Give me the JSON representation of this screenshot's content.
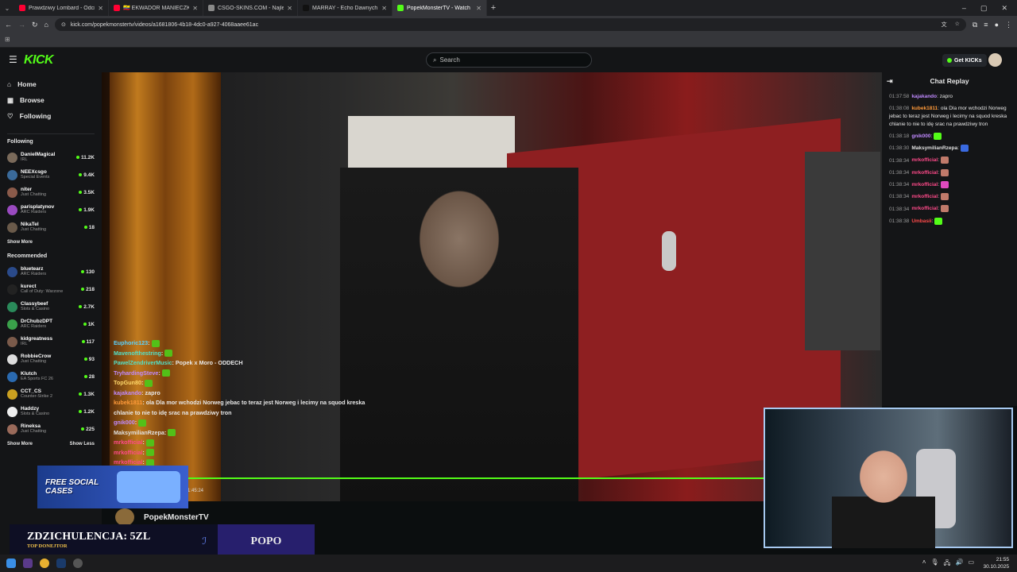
{
  "browser": {
    "tabs": [
      {
        "title": "Prawdziwy Lombard - Odcinek",
        "color": "#ff0033"
      },
      {
        "title": "🇪🇨 EKWADOR MANIECZKI",
        "color": "#ff0033"
      },
      {
        "title": "CSGO-SKINS.COM - Najlepsze",
        "color": "#8a8a8a"
      },
      {
        "title": "MARRAY - Echo Dawnych Lat |",
        "color": "#111111"
      },
      {
        "title": "PopekMonsterTV - Watch",
        "color": "#53fc18"
      }
    ],
    "url": "kick.com/popekmonstertv/videos/a1681806-4b18-4dc0-a927-4068aaee61ac"
  },
  "header": {
    "logo": "KICK",
    "search_placeholder": "Search",
    "get_kicks": "Get KICKs"
  },
  "sidebar": {
    "nav": [
      {
        "label": "Home",
        "icon": "home-icon"
      },
      {
        "label": "Browse",
        "icon": "browse-icon"
      },
      {
        "label": "Following",
        "icon": "heart-icon"
      }
    ],
    "following_title": "Following",
    "following": [
      {
        "name": "DanielMagical",
        "category": "IRL",
        "viewers": "11.2K",
        "color": "#7a6a5a"
      },
      {
        "name": "NEEXcsgo",
        "category": "Special Events",
        "viewers": "9.4K",
        "color": "#3a6a9a"
      },
      {
        "name": "niter",
        "category": "Just Chatting",
        "viewers": "3.5K",
        "color": "#8a5a4a"
      },
      {
        "name": "parisplatynov",
        "category": "ARC Raiders",
        "viewers": "1.9K",
        "color": "#9a4ac0"
      },
      {
        "name": "NikaTel",
        "category": "Just Chatting",
        "viewers": "18",
        "color": "#6a5a4a"
      }
    ],
    "show_more_1": "Show More",
    "recommended_title": "Recommended",
    "recommended": [
      {
        "name": "bluetearz",
        "category": "ARC Raiders",
        "viewers": "130",
        "color": "#2a4a8a"
      },
      {
        "name": "kurect",
        "category": "Call of Duty: Warzone",
        "viewers": "218",
        "color": "#222222"
      },
      {
        "name": "Classybeef",
        "category": "Slots & Casino",
        "viewers": "2.7K",
        "color": "#2a8a5a"
      },
      {
        "name": "DrChubzDPT",
        "category": "ARC Raiders",
        "viewers": "1K",
        "color": "#3aa04a"
      },
      {
        "name": "kidgreatness",
        "category": "IRL",
        "viewers": "117",
        "color": "#7a5a4a"
      },
      {
        "name": "RobbieCrow",
        "category": "Just Chatting",
        "viewers": "93",
        "color": "#dddddd"
      },
      {
        "name": "Klutch",
        "category": "EA Sports FC 26",
        "viewers": "28",
        "color": "#2a6ab0"
      },
      {
        "name": "CCT_CS",
        "category": "Counter-Strike 2",
        "viewers": "1.3K",
        "color": "#caa020"
      },
      {
        "name": "Haddzy",
        "category": "Slots & Casino",
        "viewers": "1.2K",
        "color": "#eeeeee"
      },
      {
        "name": "Rineksa",
        "category": "Just Chatting",
        "viewers": "225",
        "color": "#9a6a5a"
      }
    ],
    "show_more_2": "Show More",
    "show_less": "Show Less",
    "promo": "FREE SOCIAL CASES"
  },
  "video": {
    "overlay_chat": [
      {
        "user": "Euphoric123",
        "color": "#5ad3ff",
        "text": ""
      },
      {
        "user": "Mavenofthestring",
        "color": "#53e0c8",
        "text": ""
      },
      {
        "user": "PawelZendriverMusic",
        "color": "#53e0c8",
        "text": "Popek x Moro - ODDECH"
      },
      {
        "user": "TryhardingSteve",
        "color": "#c08aff",
        "text": ""
      },
      {
        "user": "TopGun80",
        "color": "#ffd86a",
        "text": ""
      },
      {
        "user": "kajakando",
        "color": "#c08aff",
        "text": "zapro"
      },
      {
        "user": "kubek1811",
        "color": "#ff9a3a",
        "text": "ola Dla mor wchodzi Norweg jebac to teraz jest Norweg i lecimy na squod kreska chlanie to nie to idę srac na prawdziwy tron"
      },
      {
        "user": "gnik000",
        "color": "#c08aff",
        "text": ""
      },
      {
        "user": "MaksymilianRzepa",
        "color": "#e0e0e0",
        "text": ""
      },
      {
        "user": "mrkofficial",
        "color": "#ff4a8a",
        "text": ""
      },
      {
        "user": "mrkofficial",
        "color": "#ff4a8a",
        "text": ""
      },
      {
        "user": "mrkofficial",
        "color": "#ff4a8a",
        "text": ""
      }
    ],
    "progress": 1.0,
    "timestamp": "1:45:24",
    "streamer": "PopekMonsterTV"
  },
  "donation": {
    "name": "ZDZICHULENCJA: 5ZL",
    "subtitle": "TOP DONEJTOR",
    "right": "POPO"
  },
  "chat": {
    "title": "Chat Replay",
    "messages": [
      {
        "time": "01:37:58",
        "user": "kajakando",
        "color": "#c08aff",
        "text": "zapro",
        "emote": ""
      },
      {
        "time": "01:38:08",
        "user": "kubek1811",
        "color": "#ff9a3a",
        "text": "ola Dla mor wchodzi Norweg jebac to teraz jest Norweg i lecimy na squod kreska chlanie to nie to idę srac na prawdziwy tron",
        "emote": ""
      },
      {
        "time": "01:38:18",
        "user": "gnik000",
        "color": "#c08aff",
        "text": "",
        "emote": "#53fc18"
      },
      {
        "time": "01:38:30",
        "user": "MaksymilianRzepa",
        "color": "#e0e0e0",
        "text": "",
        "emote": "#3a6ae0"
      },
      {
        "time": "01:38:34",
        "user": "mrkofficial",
        "color": "#ff4a8a",
        "text": "",
        "emote": "#c07a6a"
      },
      {
        "time": "01:38:34",
        "user": "mrkofficial",
        "color": "#ff4a8a",
        "text": "",
        "emote": "#c07a6a"
      },
      {
        "time": "01:38:34",
        "user": "mrkofficial",
        "color": "#ff4a8a",
        "text": "",
        "emote": "#e04ac0"
      },
      {
        "time": "01:38:34",
        "user": "mrkofficial",
        "color": "#ff4a8a",
        "text": "",
        "emote": "#c07a6a"
      },
      {
        "time": "01:38:34",
        "user": "mrkofficial",
        "color": "#ff4a8a",
        "text": "",
        "emote": "#c07a6a"
      },
      {
        "time": "01:38:38",
        "user": "Umbasii",
        "color": "#ff4a4a",
        "text": "",
        "emote": "#53fc18"
      }
    ]
  },
  "taskbar": {
    "time": "21:55",
    "date": "30.10.2025"
  }
}
